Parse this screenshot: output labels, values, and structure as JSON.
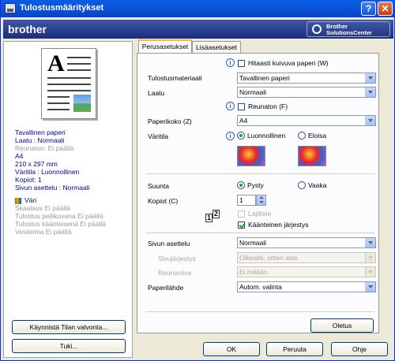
{
  "window": {
    "title": "Tulostusmääritykset",
    "help": "?",
    "close": "✕"
  },
  "banner": {
    "brand": "brother",
    "bsc_line1": "Brother",
    "bsc_line2": "SolutionsCenter"
  },
  "summary": {
    "lines": [
      "Tavallinen paperi",
      "Laatu : Normaali",
      "Reunaton: Ei päällä",
      "A4",
      "210 x 297 mm",
      "Väritila : Luonnollinen",
      "Kopiot: 1",
      "Sivun asettelu : Normaali"
    ],
    "color_label": "Väri",
    "gray_lines": [
      "Skaalaus Ei päällä",
      "Tulostus peilikuvana Ei päällä",
      "Tulostus käänteisenä Ei päällä",
      "Vesileima Ei päällä"
    ]
  },
  "left_buttons": {
    "status_monitor": "Käynnistä Tilan valvonta...",
    "support": "Tuki..."
  },
  "tabs": [
    "Perusasetukset",
    "Lisäasetukset"
  ],
  "form": {
    "fast_dry": "Hitaasti kuivuva paperi (W)",
    "media_label": "Tulostusmateriaali",
    "media_value": "Tavallinen paperi",
    "quality_label": "Laatu",
    "quality_value": "Normaali",
    "borderless": "Reunaton (F)",
    "paper_size_label": "Paperikoko (Z)",
    "paper_size_value": "A4",
    "color_mode_label": "Väritila",
    "natural": "Luonnollinen",
    "vivid": "Eloisa",
    "orientation_label": "Suunta",
    "portrait": "Pysty",
    "landscape": "Vaaka",
    "copies_label": "Kopiot (C)",
    "copies_value": "1",
    "collate": "Lajittele",
    "reverse_order": "Käänteinen järjestys",
    "layout_label": "Sivun asettelu",
    "layout_value": "Normaali",
    "page_order_label": "Sivujärjestys",
    "page_order_value": "Oikealle, sitten alas",
    "border_line_label": "Reunaviiva",
    "border_line_value": "Ei mitään",
    "paper_source_label": "Paperilähde",
    "paper_source_value": "Autom. valinta",
    "default_button": "Oletus",
    "info_icon": "i"
  },
  "dialog_buttons": {
    "ok": "OK",
    "cancel": "Peruuta",
    "help": "Ohje"
  },
  "colors": {
    "title_bar": "#0b4fd3",
    "banner": "#25377f",
    "summary_text": "#0000a0",
    "face": "#ece9d8"
  }
}
